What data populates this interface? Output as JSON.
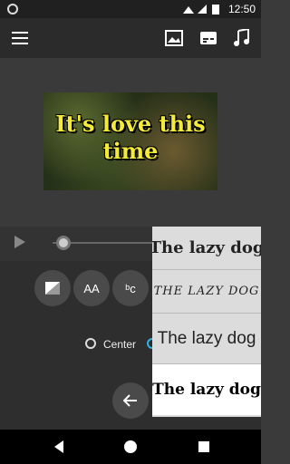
{
  "status_bar": {
    "time": "12:50",
    "icons": [
      "wifi-icon",
      "signal-icon",
      "battery-icon"
    ]
  },
  "toolbar": {
    "menu_icon": "menu-icon",
    "actions": [
      "image-icon",
      "subtitle-icon",
      "music-icon"
    ]
  },
  "preview": {
    "caption_line1": "It's love this",
    "caption_line2": "time",
    "caption_color": "#f4ea3a"
  },
  "player": {
    "play_icon": "play-icon"
  },
  "style_buttons": [
    {
      "name": "background-color-icon",
      "label": ""
    },
    {
      "name": "font-size-icon",
      "label": "AA"
    },
    {
      "name": "font-style-icon",
      "label": "ᵇc"
    }
  ],
  "alignment": {
    "center_label": "Center"
  },
  "fonts": [
    {
      "sample": "The lazy dog"
    },
    {
      "sample": "THE LAZY DOG"
    },
    {
      "sample": "The lazy dog"
    },
    {
      "sample": "The lazy dog"
    }
  ],
  "nav": [
    "back-nav-icon",
    "home-nav-icon",
    "recents-nav-icon"
  ]
}
